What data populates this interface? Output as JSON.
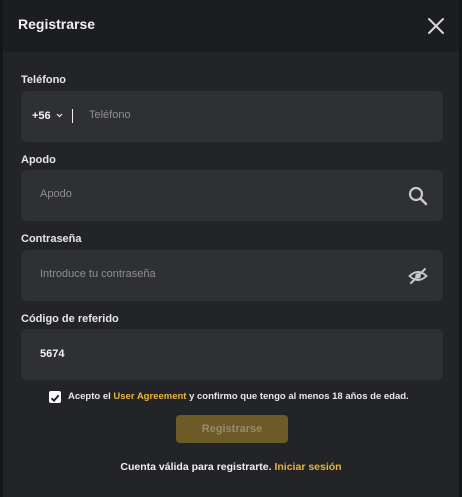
{
  "header": {
    "title": "Registrarse"
  },
  "phone": {
    "label": "Teléfono",
    "country_code": "+56",
    "placeholder": "Teléfono"
  },
  "nickname": {
    "label": "Apodo",
    "placeholder": "Apodo"
  },
  "password": {
    "label": "Contraseña",
    "placeholder": "Introduce tu contraseña"
  },
  "referral": {
    "label": "Código de referido",
    "value": "5674"
  },
  "agreement": {
    "checked": true,
    "text_before": "Acepto el ",
    "link": "User Agreement",
    "text_after": " y confirmo que tengo al menos 18 años de edad."
  },
  "submit_label": "Registrarse",
  "footer": {
    "text": "Cuenta válida para registrarte. ",
    "link": "Iniciar sesión"
  },
  "colors": {
    "accent": "#e8b53a",
    "button": "#6e5a26",
    "panel": "#232427",
    "field": "#2f3034"
  },
  "icons": [
    "close-icon",
    "chevron-down-icon",
    "search-icon",
    "eye-off-icon",
    "checkmark-icon"
  ]
}
